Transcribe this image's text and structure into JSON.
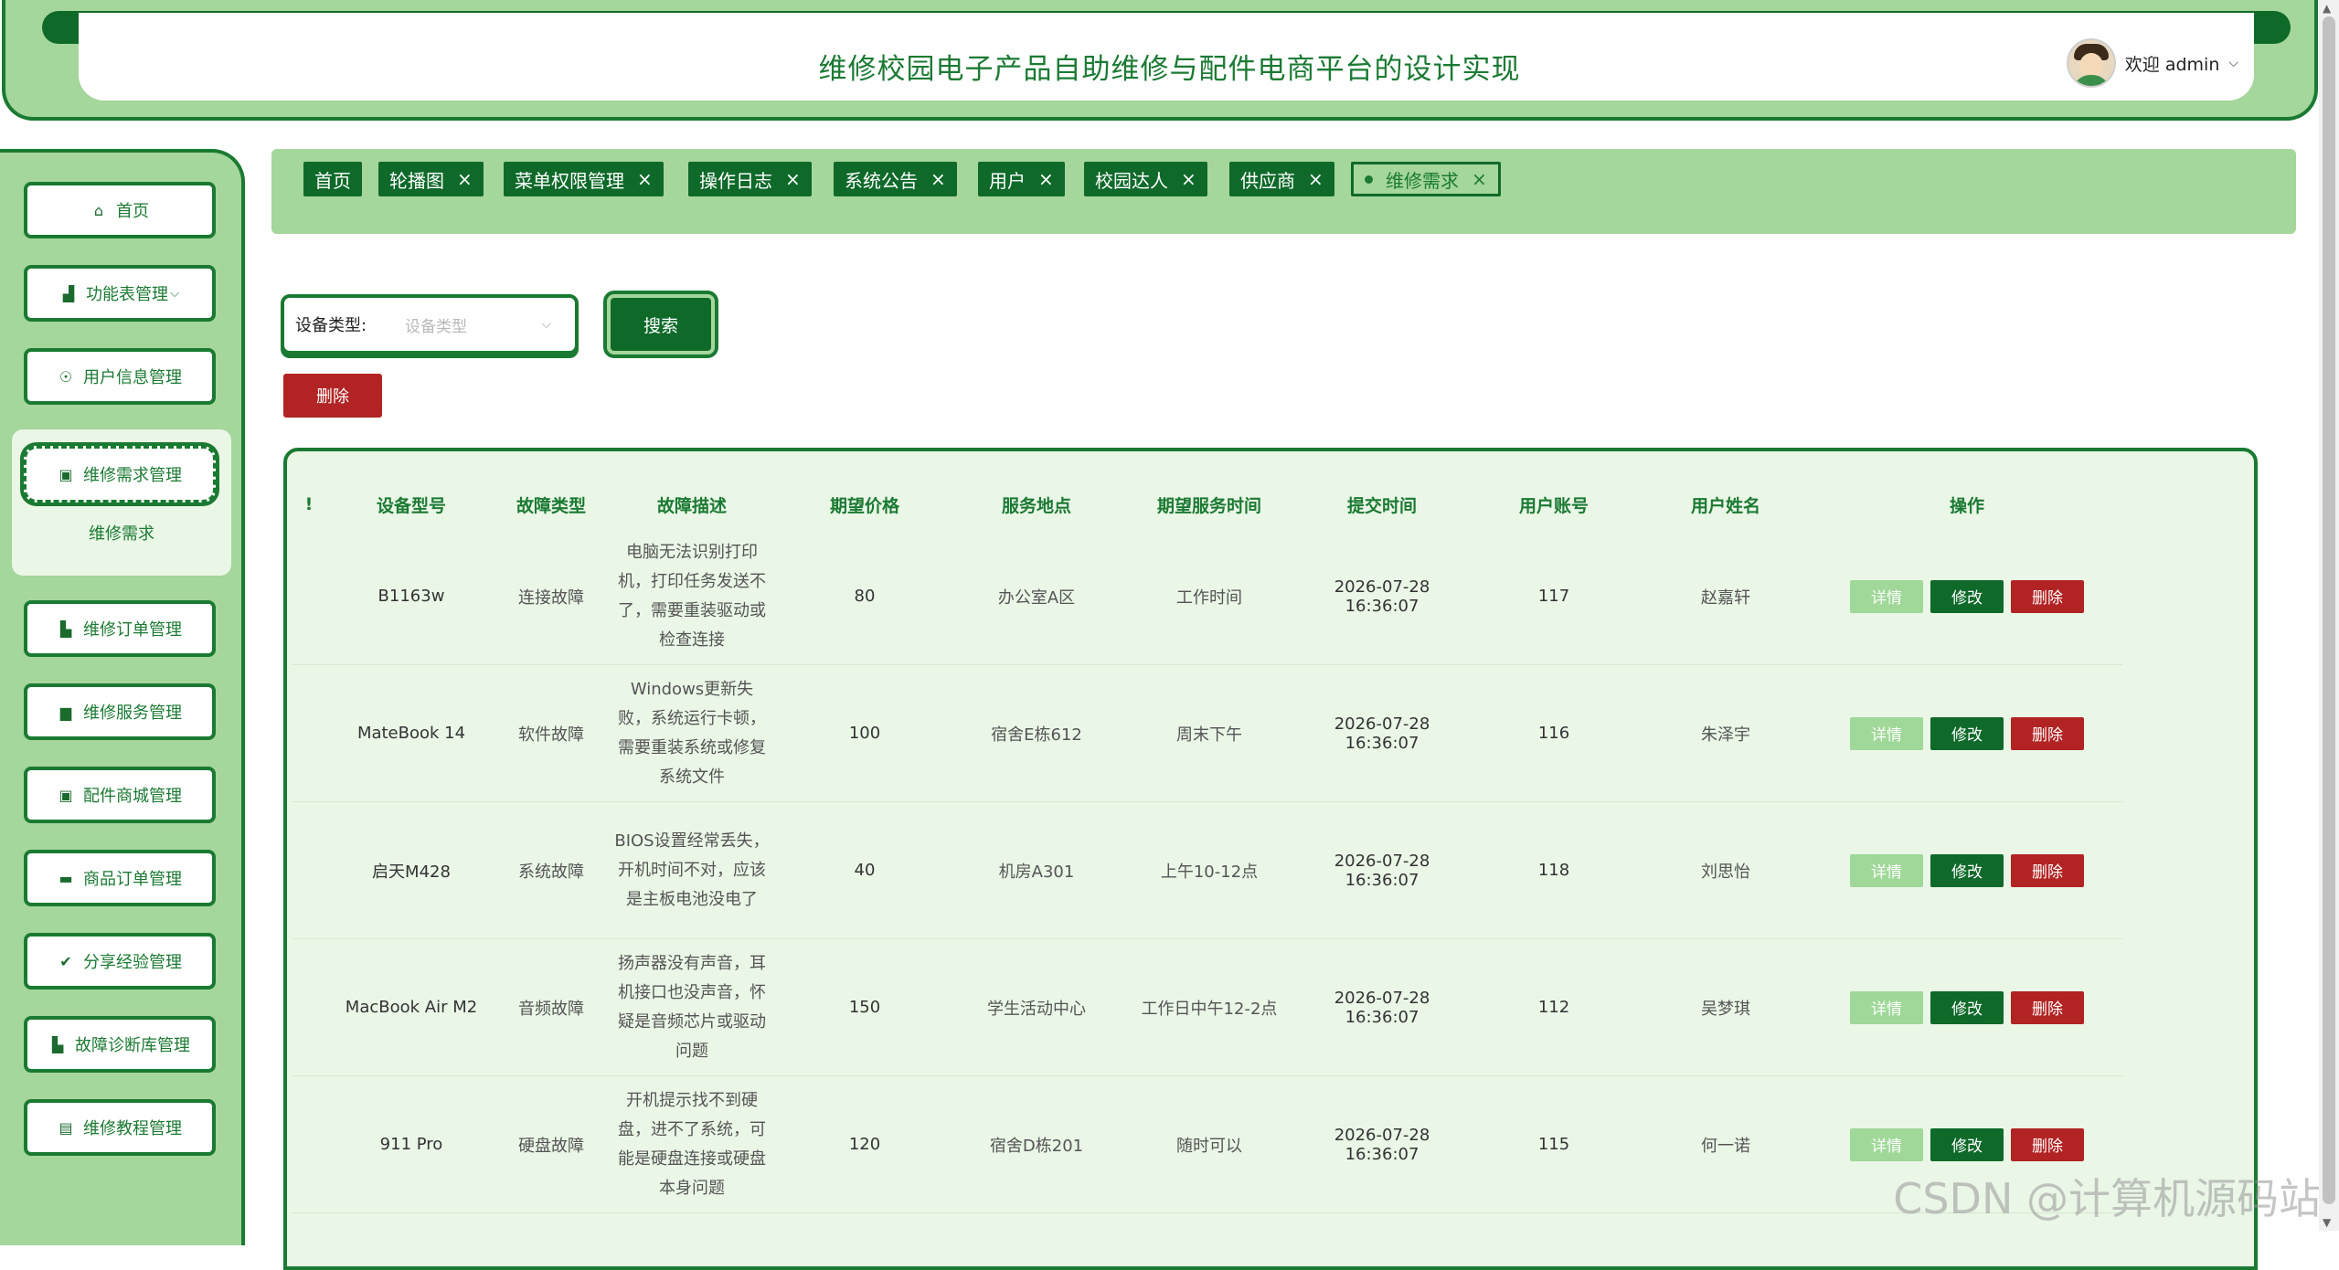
{
  "header": {
    "title": "维修校园电子产品自助维修与配件电商平台的设计实现",
    "welcome": "欢迎 admin",
    "user_chevron": "⌵"
  },
  "sidebar": {
    "items": [
      {
        "label": "首页",
        "icon": "⌂"
      },
      {
        "label": "功能表管理",
        "icon": "▟",
        "suffix": "⌵"
      },
      {
        "label": "用户信息管理",
        "icon": "☉"
      },
      {
        "label": "维修需求管理",
        "icon": "▣"
      },
      {
        "label": "维修订单管理",
        "icon": "▙"
      },
      {
        "label": "维修服务管理",
        "icon": "▆"
      },
      {
        "label": "配件商城管理",
        "icon": "▣"
      },
      {
        "label": "商品订单管理",
        "icon": "▬"
      },
      {
        "label": "分享经验管理",
        "icon": "✔"
      },
      {
        "label": "故障诊断库管理",
        "icon": "▙"
      },
      {
        "label": "维修教程管理",
        "icon": "▤"
      }
    ],
    "submenu": "维修需求"
  },
  "tabs": [
    {
      "label": "首页"
    },
    {
      "label": "轮播图",
      "close": "×"
    },
    {
      "label": "菜单权限管理",
      "close": "×"
    },
    {
      "label": "操作日志",
      "close": "×"
    },
    {
      "label": "系统公告",
      "close": "×"
    },
    {
      "label": "用户",
      "close": "×"
    },
    {
      "label": "校园达人",
      "close": "×"
    },
    {
      "label": "供应商",
      "close": "×"
    },
    {
      "label": "维修需求",
      "close": "×"
    }
  ],
  "filter": {
    "label": "设备类型:",
    "placeholder": "设备类型",
    "chevron": "⌵",
    "search": "搜索",
    "delete": "删除"
  },
  "table": {
    "columns": [
      "!",
      "设备型号",
      "故障类型",
      "故障描述",
      "期望价格",
      "服务地点",
      "期望服务时间",
      "提交时间",
      "用户账号",
      "用户姓名",
      "操作"
    ],
    "rows": [
      {
        "model": "B1163w",
        "fault": "连接故障",
        "desc": "电脑无法识别打印机，打印任务发送不了，需要重装驱动或检查连接",
        "price": "80",
        "place": "办公室A区",
        "time": "工作时间",
        "submitted": "2026-07-28 16:36:07",
        "account": "117",
        "name": "赵嘉轩"
      },
      {
        "model": "MateBook 14",
        "fault": "软件故障",
        "desc": "Windows更新失败，系统运行卡顿，需要重装系统或修复系统文件",
        "price": "100",
        "place": "宿舍E栋612",
        "time": "周末下午",
        "submitted": "2026-07-28 16:36:07",
        "account": "116",
        "name": "朱泽宇"
      },
      {
        "model": "启天M428",
        "fault": "系统故障",
        "desc": "BIOS设置经常丢失，开机时间不对，应该是主板电池没电了",
        "price": "40",
        "place": "机房A301",
        "time": "上午10-12点",
        "submitted": "2026-07-28 16:36:07",
        "account": "118",
        "name": "刘思怡"
      },
      {
        "model": "MacBook Air M2",
        "fault": "音频故障",
        "desc": "扬声器没有声音，耳机接口也没声音，怀疑是音频芯片或驱动问题",
        "price": "150",
        "place": "学生活动中心",
        "time": "工作日中午12-2点",
        "submitted": "2026-07-28 16:36:07",
        "account": "112",
        "name": "吴梦琪"
      },
      {
        "model": "911 Pro",
        "fault": "硬盘故障",
        "desc": "开机提示找不到硬盘，进不了系统，可能是硬盘连接或硬盘本身问题",
        "price": "120",
        "place": "宿舍D栋201",
        "time": "随时可以",
        "submitted": "2026-07-28 16:36:07",
        "account": "115",
        "name": "何一诺"
      }
    ],
    "actions": {
      "detail": "详情",
      "edit": "修改",
      "delete": "删除"
    }
  },
  "watermark": "CSDN @计算机源码站"
}
